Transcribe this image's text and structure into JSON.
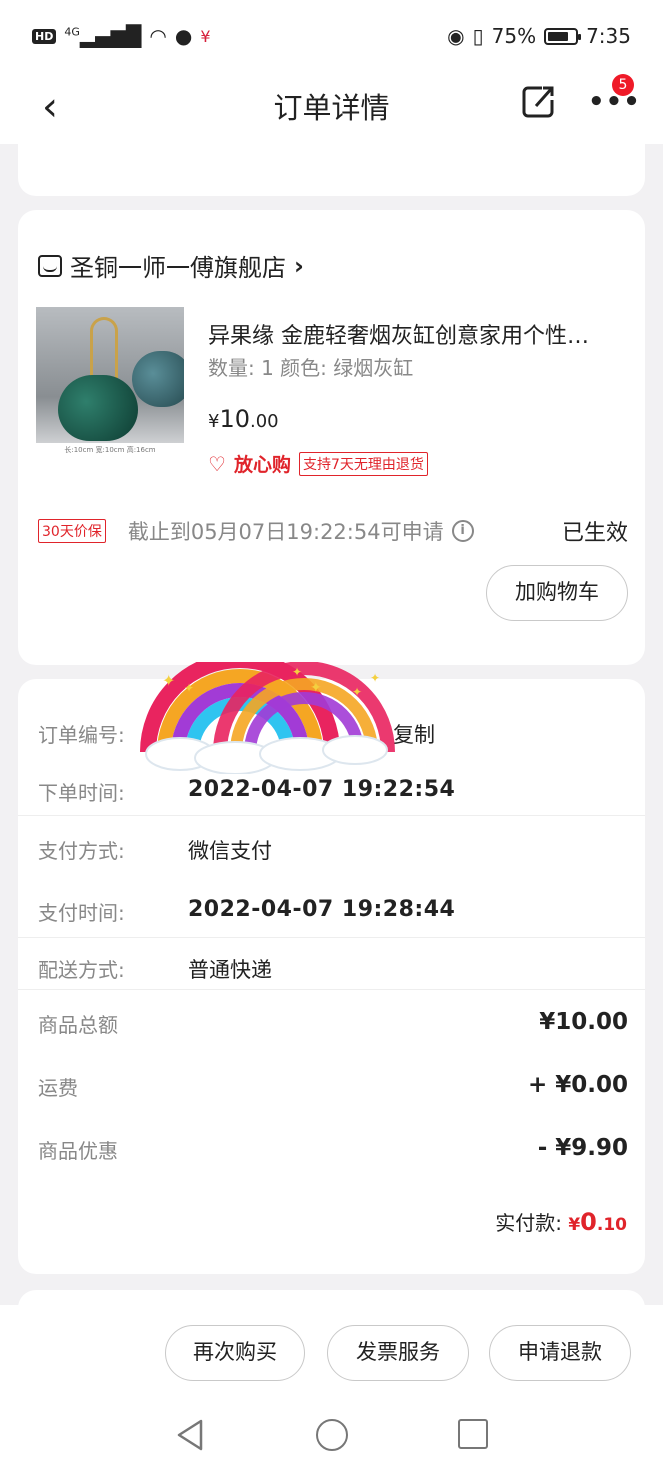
{
  "status_bar": {
    "hd": "HD",
    "network": "4G",
    "battery": "75%",
    "battery_level": 0.75,
    "time": "7:35"
  },
  "nav": {
    "title": "订单详情",
    "notification_count": "5"
  },
  "shop": {
    "name": "圣铜一师一傅旗舰店",
    "product": {
      "title": "异果缘 金鹿轻奢烟灰缸创意家用个性…",
      "spec": "数量: 1   颜色: 绿烟灰缸",
      "price_symbol": "¥",
      "price_int": "10",
      "price_dec": ".00",
      "assurance_label": "放心购",
      "return_policy": "支持7天无理由退货",
      "image_caption": "长:10cm 宽:10cm 高:16cm"
    },
    "price_protection": {
      "tag": "30天价保",
      "text": "截止到05月07日19:22:54可申请",
      "status": "已生效"
    },
    "add_to_cart": "加购物车"
  },
  "order": {
    "order_no": {
      "label": "订单编号:",
      "value": "复制"
    },
    "order_time": {
      "label": "下单时间:",
      "value": "2022-04-07 19:22:54"
    },
    "pay_method": {
      "label": "支付方式:",
      "value": "微信支付"
    },
    "pay_time": {
      "label": "支付时间:",
      "value": "2022-04-07 19:28:44"
    },
    "delivery": {
      "label": "配送方式:",
      "value": "普通快递"
    },
    "goods_total": {
      "label": "商品总额",
      "value": "¥10.00"
    },
    "shipping": {
      "label": "运费",
      "value": "+ ¥0.00"
    },
    "discount": {
      "label": "商品优惠",
      "value": "- ¥9.90"
    },
    "paid": {
      "label": "实付款:",
      "symbol": "¥",
      "int": "0",
      "dec": ".10"
    }
  },
  "actions": {
    "rebuy": "再次购买",
    "invoice": "发票服务",
    "refund": "申请退款"
  },
  "colors": {
    "accent_red": "#e0242b",
    "badge_red": "#ef1a28",
    "page_bg": "#f2f1f3"
  }
}
